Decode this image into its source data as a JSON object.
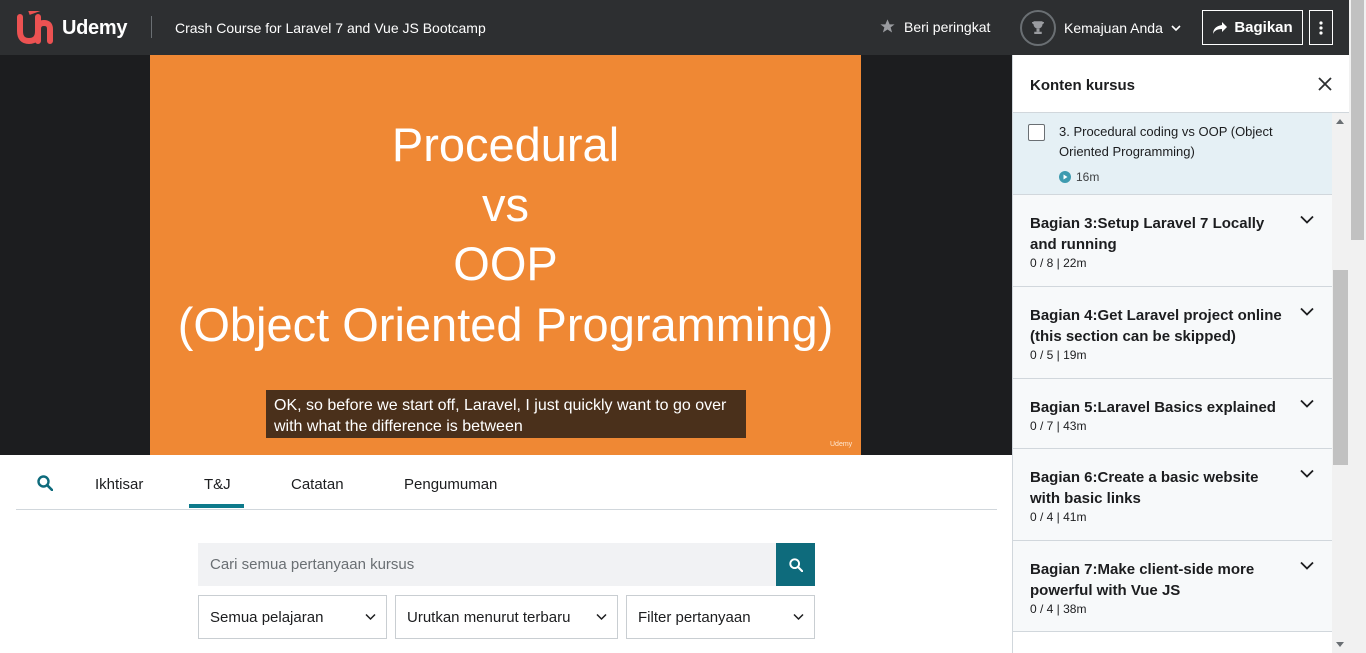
{
  "header": {
    "brand": "Udemy",
    "course_title": "Crash Course for Laravel 7 and Vue JS Bootcamp",
    "rate_label": "Beri peringkat",
    "progress_label": "Kemajuan Anda",
    "share_label": "Bagikan",
    "icons": {
      "logo": "udemy-logo-icon",
      "rate": "star-icon",
      "progress": "trophy-icon",
      "share": "share-arrow-icon",
      "more": "kebab-menu-icon"
    },
    "colors": {
      "background": "#2d2f31",
      "logo": "#ec5252"
    }
  },
  "video": {
    "slide_lines": [
      "Procedural",
      "vs",
      "OOP",
      "(Object Oriented Programming)"
    ],
    "caption": "OK, so before we start off, Laravel, I just quickly want to go over with what the difference is between",
    "watermark": "Udemy",
    "slide_color": "#ef8834"
  },
  "tabs": [
    {
      "label": "Ikhtisar",
      "active": false
    },
    {
      "label": "T&J",
      "active": true
    },
    {
      "label": "Catatan",
      "active": false
    },
    {
      "label": "Pengumuman",
      "active": false
    }
  ],
  "qa": {
    "search_placeholder": "Cari semua pertanyaan kursus",
    "filters": [
      "Semua pelajaran",
      "Urutkan menurut terbaru",
      "Filter pertanyaan"
    ],
    "accent": "#0e6b7c"
  },
  "sidebar": {
    "title": "Konten kursus",
    "current_lecture": {
      "title": "3. Procedural coding vs OOP (Object Oriented Programming)",
      "duration": "16m",
      "completed": false
    },
    "sections": [
      {
        "title": "Bagian 3:Setup Laravel 7 Locally and running",
        "meta": "0 / 8 | 22m"
      },
      {
        "title": "Bagian 4:Get Laravel project online (this section can be skipped)",
        "meta": "0 / 5 | 19m"
      },
      {
        "title": "Bagian 5:Laravel Basics explained",
        "meta": "0 / 7 | 43m"
      },
      {
        "title": "Bagian 6:Create a basic website with basic links",
        "meta": "0 / 4 | 41m"
      },
      {
        "title": "Bagian 7:Make client-side more powerful with Vue JS",
        "meta": "0 / 4 | 38m"
      }
    ]
  }
}
